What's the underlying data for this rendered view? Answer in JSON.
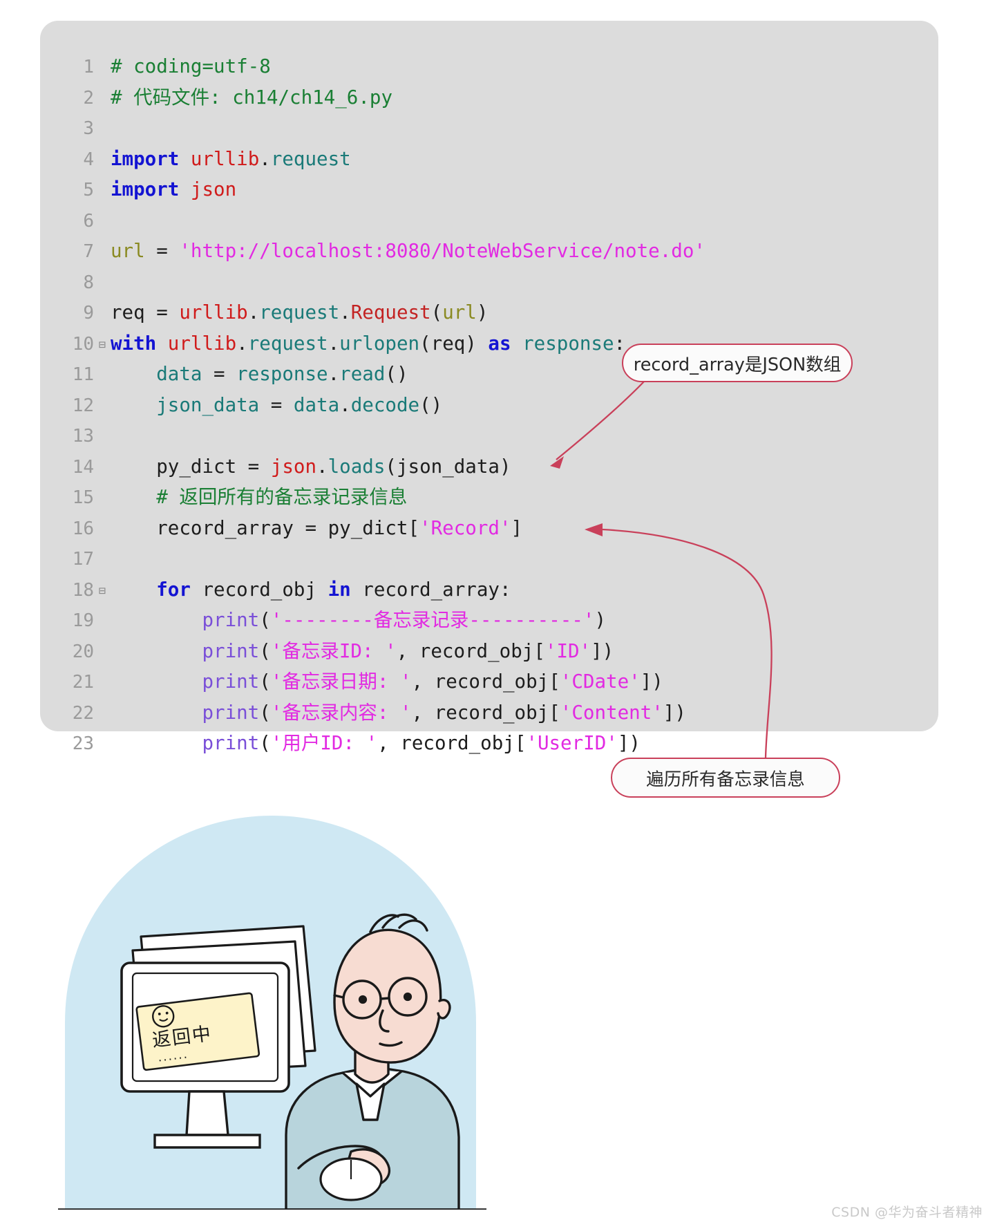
{
  "code": {
    "language": "python",
    "lines": [
      {
        "num": "1",
        "fold": "",
        "indent": 0,
        "tokens": [
          {
            "c": "comment",
            "t": "# coding=utf-8"
          }
        ]
      },
      {
        "num": "2",
        "fold": "",
        "indent": 0,
        "tokens": [
          {
            "c": "comment",
            "t": "# 代码文件: ch14/ch14_6.py"
          }
        ]
      },
      {
        "num": "3",
        "fold": "",
        "indent": 0,
        "tokens": []
      },
      {
        "num": "4",
        "fold": "",
        "indent": 0,
        "tokens": [
          {
            "c": "kw",
            "t": "import "
          },
          {
            "c": "mod",
            "t": "urllib"
          },
          {
            "c": "plain",
            "t": "."
          },
          {
            "c": "attr",
            "t": "request"
          }
        ]
      },
      {
        "num": "5",
        "fold": "",
        "indent": 0,
        "tokens": [
          {
            "c": "kw",
            "t": "import "
          },
          {
            "c": "mod",
            "t": "json"
          }
        ]
      },
      {
        "num": "6",
        "fold": "",
        "indent": 0,
        "tokens": []
      },
      {
        "num": "7",
        "fold": "",
        "indent": 0,
        "tokens": [
          {
            "c": "var",
            "t": "url"
          },
          {
            "c": "plain",
            "t": " = "
          },
          {
            "c": "str",
            "t": "'http://localhost:8080/NoteWebService/note.do'"
          }
        ]
      },
      {
        "num": "8",
        "fold": "",
        "indent": 0,
        "tokens": []
      },
      {
        "num": "9",
        "fold": "",
        "indent": 0,
        "tokens": [
          {
            "c": "plain",
            "t": "req = "
          },
          {
            "c": "mod",
            "t": "urllib"
          },
          {
            "c": "plain",
            "t": "."
          },
          {
            "c": "attr",
            "t": "request"
          },
          {
            "c": "plain",
            "t": "."
          },
          {
            "c": "func",
            "t": "Request"
          },
          {
            "c": "plain",
            "t": "("
          },
          {
            "c": "var",
            "t": "url"
          },
          {
            "c": "plain",
            "t": ")"
          }
        ]
      },
      {
        "num": "10",
        "fold": "⊟",
        "indent": 0,
        "tokens": [
          {
            "c": "kw",
            "t": "with "
          },
          {
            "c": "mod",
            "t": "urllib"
          },
          {
            "c": "plain",
            "t": "."
          },
          {
            "c": "attr",
            "t": "request"
          },
          {
            "c": "plain",
            "t": "."
          },
          {
            "c": "attr",
            "t": "urlopen"
          },
          {
            "c": "plain",
            "t": "(req) "
          },
          {
            "c": "kw",
            "t": "as "
          },
          {
            "c": "attr",
            "t": "response"
          },
          {
            "c": "plain",
            "t": ":"
          }
        ]
      },
      {
        "num": "11",
        "fold": "",
        "indent": 1,
        "tokens": [
          {
            "c": "attr",
            "t": "data"
          },
          {
            "c": "plain",
            "t": " = "
          },
          {
            "c": "attr",
            "t": "response"
          },
          {
            "c": "plain",
            "t": "."
          },
          {
            "c": "attr",
            "t": "read"
          },
          {
            "c": "plain",
            "t": "()"
          }
        ]
      },
      {
        "num": "12",
        "fold": "",
        "indent": 1,
        "tokens": [
          {
            "c": "attr",
            "t": "json_data"
          },
          {
            "c": "plain",
            "t": " = "
          },
          {
            "c": "attr",
            "t": "data"
          },
          {
            "c": "plain",
            "t": "."
          },
          {
            "c": "attr",
            "t": "decode"
          },
          {
            "c": "plain",
            "t": "()"
          }
        ]
      },
      {
        "num": "13",
        "fold": "",
        "indent": 0,
        "tokens": []
      },
      {
        "num": "14",
        "fold": "",
        "indent": 1,
        "tokens": [
          {
            "c": "plain",
            "t": "py_dict = "
          },
          {
            "c": "mod",
            "t": "json"
          },
          {
            "c": "plain",
            "t": "."
          },
          {
            "c": "attr",
            "t": "loads"
          },
          {
            "c": "plain",
            "t": "(json_data)"
          }
        ]
      },
      {
        "num": "15",
        "fold": "",
        "indent": 1,
        "tokens": [
          {
            "c": "comment",
            "t": "# 返回所有的备忘录记录信息"
          }
        ]
      },
      {
        "num": "16",
        "fold": "",
        "indent": 1,
        "tokens": [
          {
            "c": "plain",
            "t": "record_array = py_dict["
          },
          {
            "c": "str",
            "t": "'Record'"
          },
          {
            "c": "plain",
            "t": "]"
          }
        ]
      },
      {
        "num": "17",
        "fold": "",
        "indent": 0,
        "tokens": []
      },
      {
        "num": "18",
        "fold": "⊟",
        "indent": 1,
        "tokens": [
          {
            "c": "kw",
            "t": "for "
          },
          {
            "c": "plain",
            "t": "record_obj "
          },
          {
            "c": "kw",
            "t": "in "
          },
          {
            "c": "plain",
            "t": "record_array:"
          }
        ]
      },
      {
        "num": "19",
        "fold": "",
        "indent": 2,
        "tokens": [
          {
            "c": "builtin",
            "t": "print"
          },
          {
            "c": "plain",
            "t": "("
          },
          {
            "c": "str",
            "t": "'--------备忘录记录----------'"
          },
          {
            "c": "plain",
            "t": ")"
          }
        ]
      },
      {
        "num": "20",
        "fold": "",
        "indent": 2,
        "tokens": [
          {
            "c": "builtin",
            "t": "print"
          },
          {
            "c": "plain",
            "t": "("
          },
          {
            "c": "str",
            "t": "'备忘录ID: '"
          },
          {
            "c": "plain",
            "t": ", record_obj["
          },
          {
            "c": "str",
            "t": "'ID'"
          },
          {
            "c": "plain",
            "t": "])"
          }
        ]
      },
      {
        "num": "21",
        "fold": "",
        "indent": 2,
        "tokens": [
          {
            "c": "builtin",
            "t": "print"
          },
          {
            "c": "plain",
            "t": "("
          },
          {
            "c": "str",
            "t": "'备忘录日期: '"
          },
          {
            "c": "plain",
            "t": ", record_obj["
          },
          {
            "c": "str",
            "t": "'CDate'"
          },
          {
            "c": "plain",
            "t": "])"
          }
        ]
      },
      {
        "num": "22",
        "fold": "",
        "indent": 2,
        "tokens": [
          {
            "c": "builtin",
            "t": "print"
          },
          {
            "c": "plain",
            "t": "("
          },
          {
            "c": "str",
            "t": "'备忘录内容: '"
          },
          {
            "c": "plain",
            "t": ", record_obj["
          },
          {
            "c": "str",
            "t": "'Content'"
          },
          {
            "c": "plain",
            "t": "])"
          }
        ]
      },
      {
        "num": "23",
        "fold": "",
        "indent": 2,
        "tokens": [
          {
            "c": "builtin",
            "t": "print"
          },
          {
            "c": "plain",
            "t": "("
          },
          {
            "c": "str",
            "t": "'用户ID: '"
          },
          {
            "c": "plain",
            "t": ", record_obj["
          },
          {
            "c": "str",
            "t": "'UserID'"
          },
          {
            "c": "plain",
            "t": "])"
          }
        ]
      }
    ]
  },
  "callouts": {
    "record_array": "record_array是JSON数组",
    "loop": "遍历所有备忘录信息"
  },
  "illustration": {
    "screen_note_text": "返回中",
    "screen_note_dots": "......",
    "alt": "卡通人物坐在电脑前等待返回结果"
  },
  "watermark": "CSDN @华为奋斗者精神",
  "colors": {
    "panel_background": "#dcdcdc",
    "callout_border": "#c9405a",
    "comment": "#1a7f34",
    "keyword": "#1414d2",
    "module": "#d01b1b",
    "attribute": "#1a7a78",
    "string": "#e22ae2",
    "function": "#c32222",
    "illustration_backdrop": "#cfe8f3",
    "watermark": "#c9c9c9"
  }
}
